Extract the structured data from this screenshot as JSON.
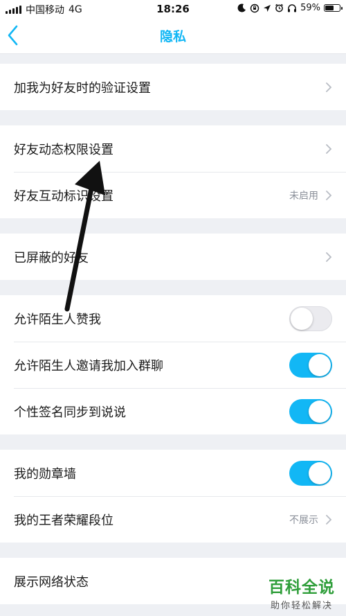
{
  "status_bar": {
    "carrier": "中国移动",
    "network": "4G",
    "time": "18:26",
    "battery_percent_text": "59%",
    "battery_level": 0.59
  },
  "nav": {
    "title": "隐私",
    "back_icon": "chevron-left-icon"
  },
  "colors": {
    "accent": "#12b7f5",
    "background": "#eef0f4",
    "watermark_green": "#2f9e3a"
  },
  "settings": {
    "friend_verification": {
      "label": "加我为好友时的验证设置"
    },
    "friend_moments_permission": {
      "label": "好友动态权限设置"
    },
    "friend_interaction_marks": {
      "label": "好友互动标识设置",
      "value": "未启用"
    },
    "blocked_friends": {
      "label": "已屏蔽的好友"
    },
    "allow_stranger_likes": {
      "label": "允许陌生人赞我",
      "enabled": false
    },
    "allow_stranger_group_invite": {
      "label": "允许陌生人邀请我加入群聊",
      "enabled": true
    },
    "signature_sync": {
      "label": "个性签名同步到说说",
      "enabled": true
    },
    "medal_wall": {
      "label": "我的勋章墙",
      "enabled": true
    },
    "honor_of_kings_rank": {
      "label": "我的王者荣耀段位",
      "value": "不展示"
    },
    "network_status": {
      "label": "展示网络状态"
    }
  },
  "watermark": {
    "title": "百科全说",
    "subtitle": "助你轻松解决"
  }
}
